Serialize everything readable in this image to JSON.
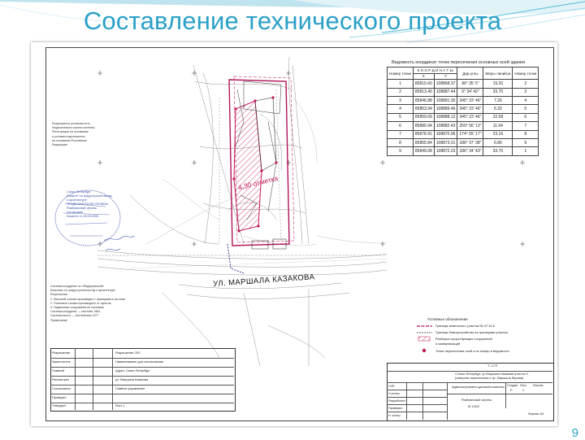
{
  "slide": {
    "title": "Составление технического проекта",
    "page_number": "9"
  },
  "colors": {
    "title": "#2aa0c7",
    "boundary": "#b0135a",
    "building_hatch": "#c2185b",
    "stamp": "#3a4fa8"
  },
  "coordinates_table": {
    "title": "Ведомость координат точек пересечения основных осей здания",
    "header": [
      "Номер точки",
      "К О О Р Д И Н А Т Ы",
      "Дир.углы",
      "Меры линий,м",
      "Номер точки"
    ],
    "subheader": [
      "X",
      "Y"
    ],
    "rows": [
      [
        "1",
        "85815.60",
        "108868.37",
        "96° 35' 5\"",
        "19.20",
        "2"
      ],
      [
        "2",
        "85813.40",
        "108887.44",
        "6° 34' 43\"",
        "33.70",
        "3"
      ],
      [
        "3",
        "85846.88",
        "108891.30",
        "345° 23' 46\"",
        "7.29",
        "4"
      ],
      [
        "4",
        "85853.94",
        "108889.46",
        "345° 23' 46\"",
        "5.33",
        "5"
      ],
      [
        "5",
        "85859.09",
        "108888.12",
        "345° 23' 46\"",
        "22.58",
        "6"
      ],
      [
        "6",
        "85880.94",
        "108882.43",
        "259° 56' 13\"",
        "11.64",
        "7"
      ],
      [
        "7",
        "85878.91",
        "108870.96",
        "174° 55' 17\"",
        "23.16",
        "8"
      ],
      [
        "8",
        "85855.84",
        "108873.01",
        "186° 37' 38\"",
        "6.80",
        "9"
      ],
      [
        "9",
        "85849.08",
        "108872.23",
        "186° 34' 43\"",
        "33.70",
        "1"
      ]
    ]
  },
  "map": {
    "street_label": "УЛ. МАРШАЛА  КАЗАКОВА",
    "zone_label": "4.30 отметка"
  },
  "legend": {
    "title": "Условные обозначения",
    "items": [
      "Граница земельного участка № 47:14:0",
      "Граница благоустройства за границами участка",
      "Разборка существующих сооружений",
      "и коммуникаций",
      "Точки пересечения осей и их номер в ведомости"
    ]
  },
  "stamp": {
    "lines": [
      "Санкт-Петербург",
      "Комитет по градостроительству",
      "и архитектуре",
      "ГЕОДЕЗИЧЕСКОЙ СЛУЖБЫ",
      "Разбивочный чертеж",
      "согласован",
      "Комитет от 28.03.2006"
    ]
  },
  "left_notes": [
    "Разрешается условная сеть",
    "геодезического пункта системы",
    "Регистрация на основании",
    "и условия подготовлены",
    "на основании Российская",
    "Федерация"
  ],
  "bottom_notes": [
    "Система координат по «Федеральный»",
    "Комплекс по градостроительству и архитектуре",
    "Разрешение:",
    "1. Масштаб съемки произведен с границами в системе",
    "2. Плановое съемки произведено от пунктов",
    "3. Надземные сооружения не показаны",
    "Система координат — местная 1964",
    "Система высот — Балтийская 1977",
    "Примечание"
  ],
  "approval_block": {
    "rows": [
      "Разрешение",
      "Заместитель",
      "Главный",
      "Рассмотрел",
      "Согласовано",
      "Проверил",
      "Утвердил"
    ],
    "right_lines": [
      "Разрешение: 200",
      "Наименование для согласования",
      "Адрес: Санкт-Петербург",
      "ул. Маршала Казакова",
      "Главное управление",
      "Лист 1"
    ]
  },
  "title_block": {
    "code": "Т.    1-ГП",
    "address": "г.Санкт-Петербург, ул.Маршала Казакова участок 2",
    "address2": "(севернее пересечения с пр. Маршала Жукова)",
    "object": "Административно-деловой комплекс",
    "stage_label": "Стадия",
    "sheet_label": "Лист",
    "sheets_label": "Листов",
    "stage": "Р",
    "sheet": "2",
    "drawing": "Разбивочный чертеж",
    "scale": "М 1:500",
    "roles": [
      "ГИП",
      "Н.контр.",
      "Разработал",
      "Проверил",
      "Н. контр."
    ],
    "format": "Формат А3"
  }
}
